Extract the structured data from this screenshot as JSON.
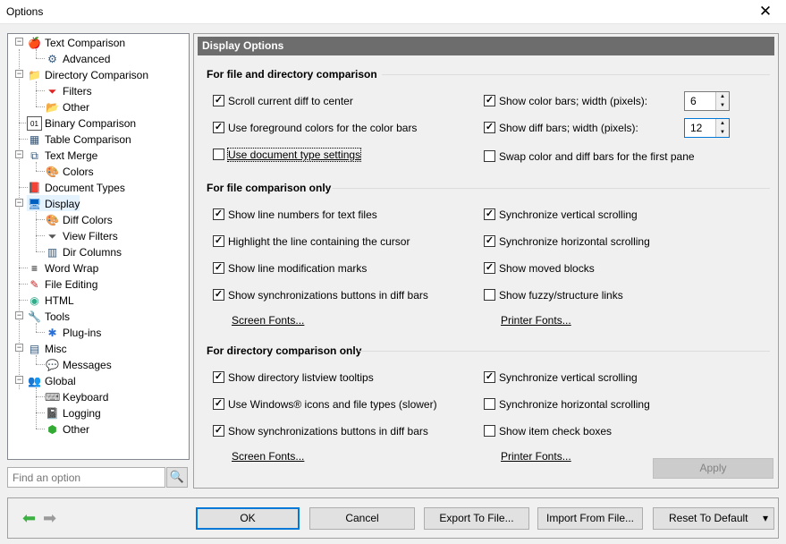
{
  "window": {
    "title": "Options",
    "close_label": "✕"
  },
  "tree": {
    "items": [
      {
        "label": "Text Comparison",
        "icon": "🍎"
      },
      {
        "label": "Advanced",
        "icon": "⚙"
      },
      {
        "label": "Directory Comparison",
        "icon": "📁"
      },
      {
        "label": "Filters",
        "icon": "⏷"
      },
      {
        "label": "Other",
        "icon": "📂"
      },
      {
        "label": "Binary Comparison",
        "icon": "01"
      },
      {
        "label": "Table Comparison",
        "icon": "▦"
      },
      {
        "label": "Text Merge",
        "icon": "⧉"
      },
      {
        "label": "Colors",
        "icon": "🎨"
      },
      {
        "label": "Document Types",
        "icon": "📕"
      },
      {
        "label": "Display",
        "icon": "🖥"
      },
      {
        "label": "Diff Colors",
        "icon": "🎨"
      },
      {
        "label": "View Filters",
        "icon": "⏷"
      },
      {
        "label": "Dir Columns",
        "icon": "▥"
      },
      {
        "label": "Word Wrap",
        "icon": "≡"
      },
      {
        "label": "File Editing",
        "icon": "✎"
      },
      {
        "label": "HTML",
        "icon": "◉"
      },
      {
        "label": "Tools",
        "icon": "🔧"
      },
      {
        "label": "Plug-ins",
        "icon": "✱"
      },
      {
        "label": "Misc",
        "icon": "▤"
      },
      {
        "label": "Messages",
        "icon": "💬"
      },
      {
        "label": "Global",
        "icon": "👥"
      },
      {
        "label": "Keyboard",
        "icon": "⌨"
      },
      {
        "label": "Logging",
        "icon": "📓"
      },
      {
        "label": "Other",
        "icon": "⬢"
      }
    ]
  },
  "search": {
    "placeholder": "Find an option",
    "icon": "🔍"
  },
  "panel": {
    "title": "Display Options",
    "section1": {
      "heading": "For file and directory comparison",
      "scroll_center": "Scroll current diff to center",
      "use_fg_colors": "Use foreground colors for the color bars",
      "use_doc_type": "Use document type settings",
      "show_color_bars": "Show color bars; width (pixels):",
      "color_bars_width": "6",
      "show_diff_bars": "Show diff bars; width (pixels):",
      "diff_bars_width": "12",
      "swap_bars": "Swap color and diff bars for the first pane"
    },
    "section2": {
      "heading": "For file comparison only",
      "line_numbers": "Show line numbers for text files",
      "highlight_line": "Highlight the line containing the cursor",
      "mod_marks": "Show line modification marks",
      "sync_buttons": "Show synchronizations buttons in diff bars",
      "sync_vertical": "Synchronize vertical scrolling",
      "sync_horizontal": "Synchronize horizontal scrolling",
      "moved_blocks": "Show moved blocks",
      "fuzzy_links": "Show fuzzy/structure links",
      "screen_fonts": "Screen Fonts...",
      "printer_fonts": "Printer Fonts..."
    },
    "section3": {
      "heading": "For directory comparison only",
      "listview_tooltips": "Show directory listview tooltips",
      "windows_icons": "Use Windows® icons and file types (slower)",
      "sync_buttons": "Show synchronizations buttons in diff bars",
      "sync_vertical": "Synchronize vertical scrolling",
      "sync_horizontal": "Synchronize horizontal scrolling",
      "check_boxes": "Show item check boxes",
      "screen_fonts": "Screen Fonts...",
      "printer_fonts": "Printer Fonts..."
    },
    "apply_label": "Apply"
  },
  "footer": {
    "back_icon": "⬅",
    "forward_icon": "➡",
    "ok": "OK",
    "cancel": "Cancel",
    "export": "Export To File...",
    "import": "Import From File...",
    "reset": "Reset To Default",
    "reset_dropdown": "▾"
  },
  "check": "✓"
}
